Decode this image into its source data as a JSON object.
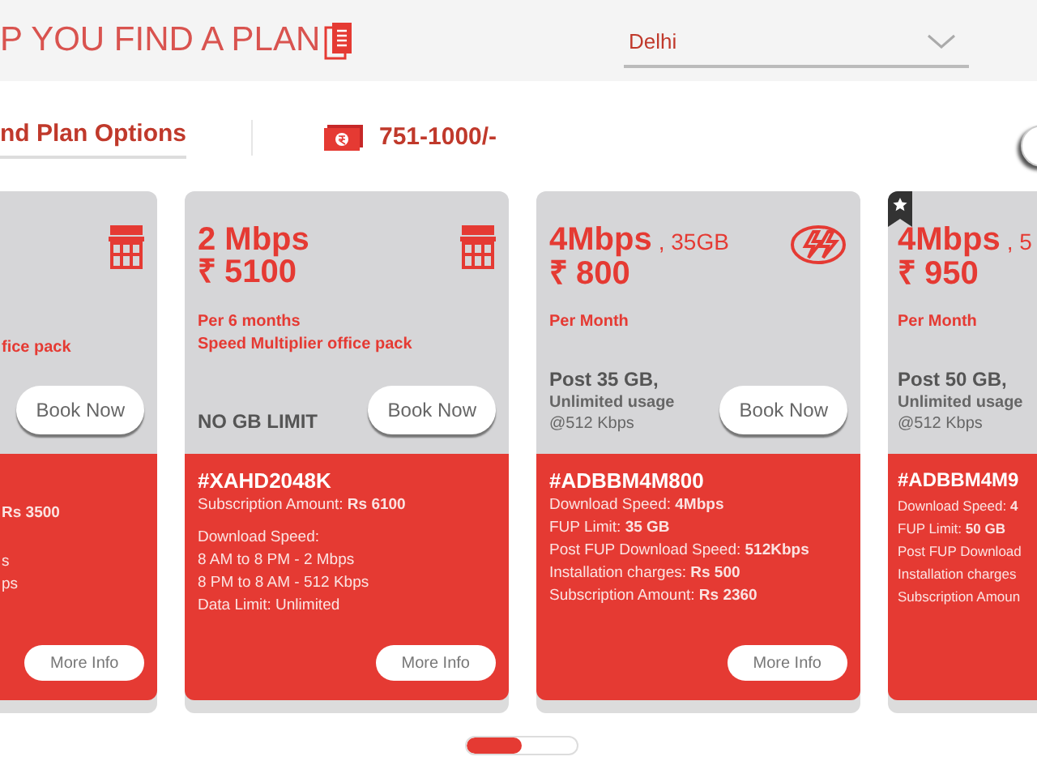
{
  "header": {
    "title": "P YOU FIND A PLAN",
    "location": {
      "value": "Delhi"
    }
  },
  "filters": [
    {
      "kind": "tab",
      "label": "nd Plan Options",
      "selected": true
    },
    {
      "kind": "price",
      "label": "751-1000/-"
    }
  ],
  "plans": [
    {
      "featured": false,
      "notes": [
        "fice pack"
      ],
      "book": "Book Now",
      "detail_groups": [
        [
          "**Rs 3500**"
        ],
        [
          "s",
          "ps"
        ]
      ],
      "more": "More Info"
    },
    {
      "featured": false,
      "speed": "2 Mbps",
      "price": "₹ 5100",
      "notes": [
        "Per 6 months",
        "Speed Multiplier office pack"
      ],
      "usage": [
        {
          "kind": "strong",
          "text": "NO GB LIMIT"
        }
      ],
      "book": "Book Now",
      "code": "#XAHD2048K",
      "detail_groups": [
        [
          "Subscription Amount: **Rs 6100**"
        ],
        [
          "Download Speed:",
          "8 AM to 8 PM - 2 Mbps",
          "8 PM to 8 AM - 512 Kbps",
          "Data Limit: Unlimited"
        ]
      ],
      "more": "More Info"
    },
    {
      "featured": false,
      "speed": "4Mbps",
      "data": ", 35GB",
      "price": "₹ 800",
      "notes": [
        "Per Month"
      ],
      "usage": [
        {
          "kind": "strong",
          "text": "Post 35 GB,"
        },
        {
          "kind": "medium",
          "text": "Unlimited usage"
        },
        {
          "kind": "plain",
          "text": "@512 Kbps"
        }
      ],
      "book": "Book Now",
      "code": "#ADBBM4M800",
      "detail_groups": [
        [
          "Download Speed: **4Mbps**",
          "FUP Limit: **35 GB**",
          "Post FUP Download Speed: **512Kbps**",
          "Installation charges: **Rs 500**",
          "Subscription Amount: **Rs 2360**"
        ]
      ],
      "more": "More Info"
    },
    {
      "featured": true,
      "speed": "4Mbps",
      "data": ", 5",
      "price": "₹ 950",
      "notes": [
        "Per Month"
      ],
      "usage": [
        {
          "kind": "strong",
          "text": "Post 50 GB,"
        },
        {
          "kind": "medium",
          "text": "Unlimited usage"
        },
        {
          "kind": "plain",
          "text": "@512 Kbps"
        }
      ],
      "code": "#ADBBM4M9",
      "detail_groups": [
        [
          "Download Speed: **4**",
          "FUP Limit: **50 GB**",
          "Post FUP Download",
          "Installation charges",
          "Subscription Amoun"
        ]
      ]
    }
  ],
  "carousel_indicator": {
    "level": 0.5
  }
}
